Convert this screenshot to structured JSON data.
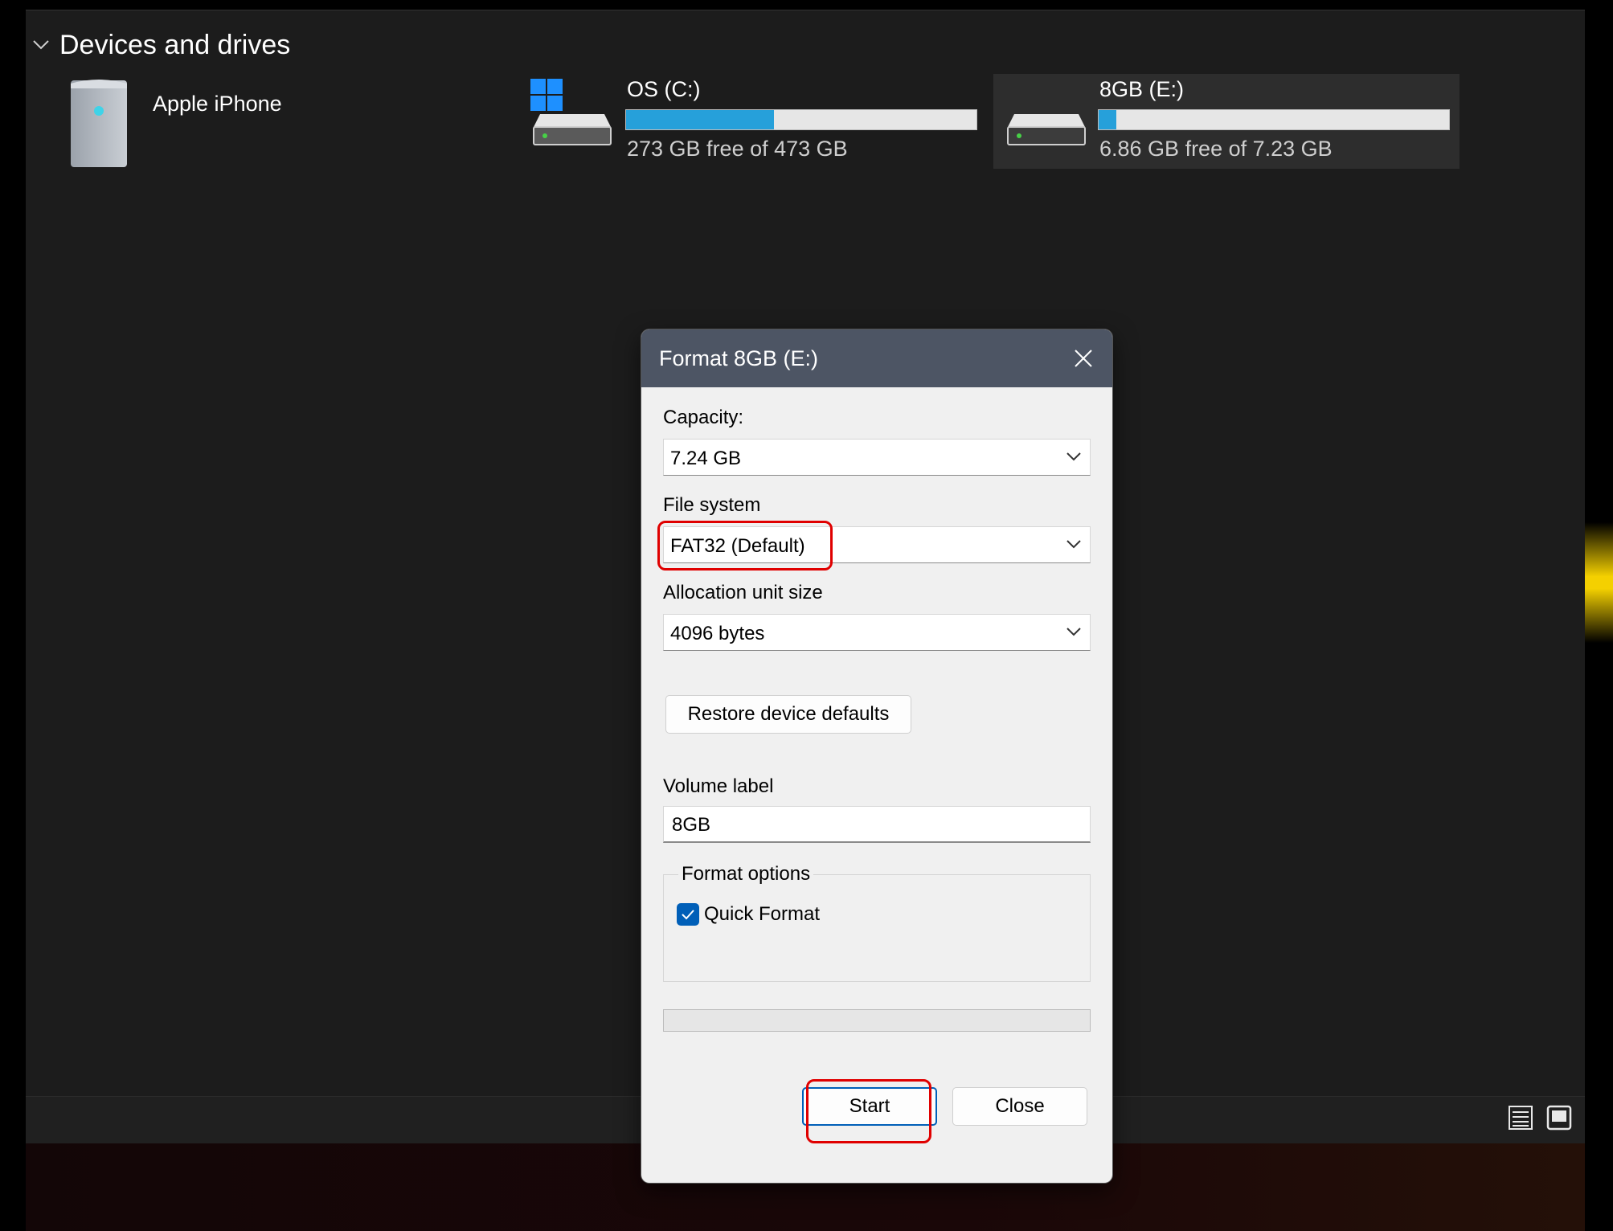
{
  "explorer": {
    "section_title": "Devices and drives",
    "devices": [
      {
        "name": "Apple iPhone"
      }
    ],
    "drives": [
      {
        "label": "OS (C:)",
        "subtitle": "273 GB free of 473 GB",
        "used_fraction": 0.423
      },
      {
        "label": "8GB (E:)",
        "subtitle": "6.86 GB free of 7.23 GB",
        "used_fraction": 0.051
      }
    ]
  },
  "dialog": {
    "title": "Format 8GB (E:)",
    "capacity_label": "Capacity:",
    "capacity_value": "7.24 GB",
    "filesystem_label": "File system",
    "filesystem_value": "FAT32 (Default)",
    "allocation_label": "Allocation unit size",
    "allocation_value": "4096 bytes",
    "restore_button": "Restore device defaults",
    "volume_label_label": "Volume label",
    "volume_label_value": "8GB",
    "format_options_label": "Format options",
    "quick_format_label": "Quick Format",
    "quick_format_checked": true,
    "progress": 0,
    "start_button": "Start",
    "close_button": "Close"
  },
  "colors": {
    "accent": "#26a0da",
    "highlight": "#e00000",
    "titlebar": "#4d5564",
    "checkbox": "#005fb8"
  }
}
